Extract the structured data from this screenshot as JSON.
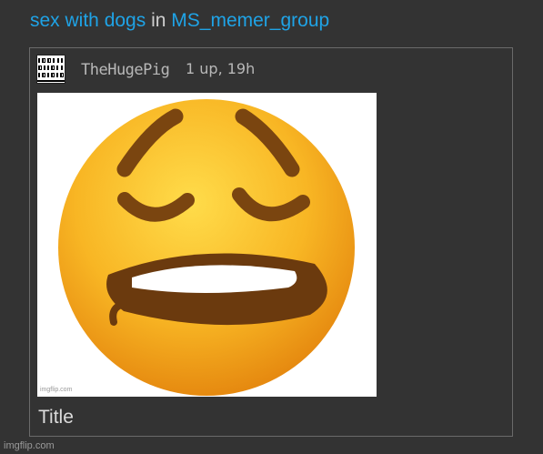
{
  "header": {
    "post_title": "sex with dogs",
    "connector": "in",
    "group_name": "MS_memer_group"
  },
  "post": {
    "author": "TheHugePig",
    "meta": "1 up, 19h",
    "image_watermark": "imgflip.com",
    "caption": "Title"
  },
  "footer": {
    "watermark": "imgflip.com"
  },
  "colors": {
    "background": "#333333",
    "link": "#1fa3e6",
    "emoji_yellow": "#f7b21c",
    "emoji_brown": "#7a4510"
  },
  "icons": {
    "avatar": "binary-digits-avatar",
    "meme": "weary-lip-biting-emoji"
  }
}
